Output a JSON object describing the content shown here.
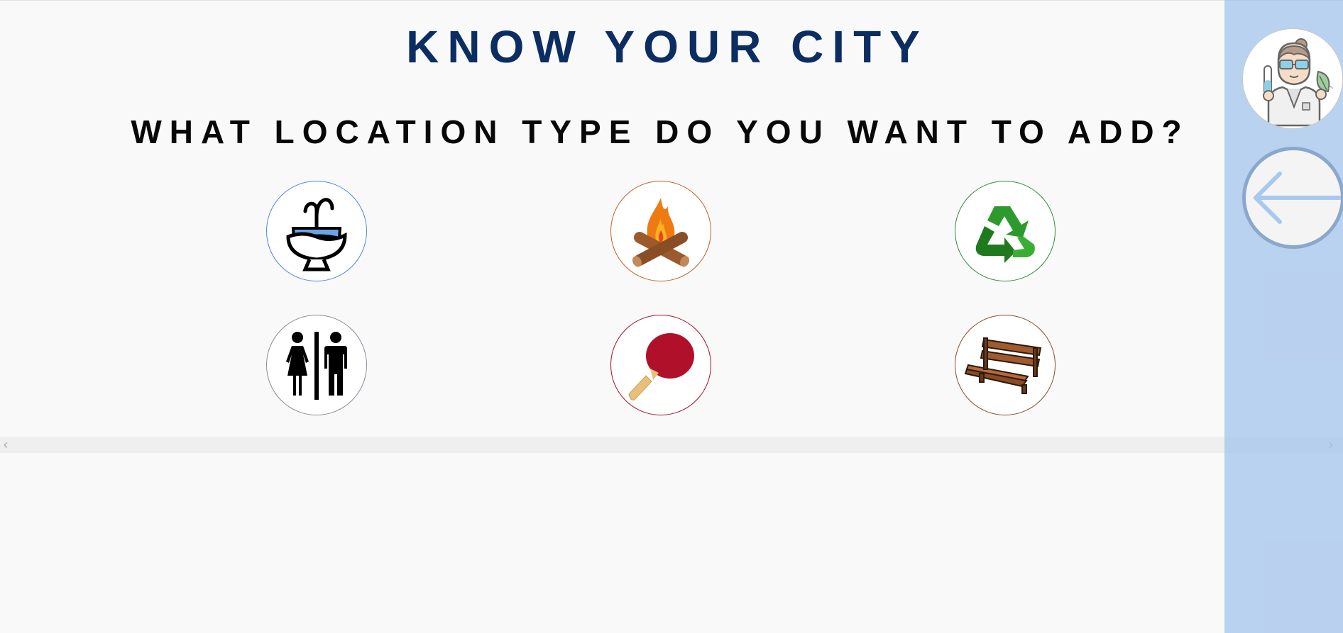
{
  "header": {
    "title": "KNOW YOUR CITY"
  },
  "prompt": {
    "question": "WHAT LOCATION TYPE DO YOU WANT TO ADD?"
  },
  "location_types": [
    {
      "icon": "water-fountain-icon",
      "border_color": "#4a86e8"
    },
    {
      "icon": "campfire-icon",
      "border_color": "#c0622a"
    },
    {
      "icon": "recycling-icon",
      "border_color": "#2e8b3c"
    },
    {
      "icon": "restroom-icon",
      "border_color": "#8a8a9a"
    },
    {
      "icon": "ping-pong-icon",
      "border_color": "#a8102a"
    },
    {
      "icon": "park-bench-icon",
      "border_color": "#8a4a2c"
    }
  ],
  "side_panel": {
    "avatar_icon": "scientist-avatar-icon",
    "back_icon": "arrow-left-icon"
  },
  "colors": {
    "title": "#0b2d62",
    "side_panel": "#bcd3ef"
  }
}
